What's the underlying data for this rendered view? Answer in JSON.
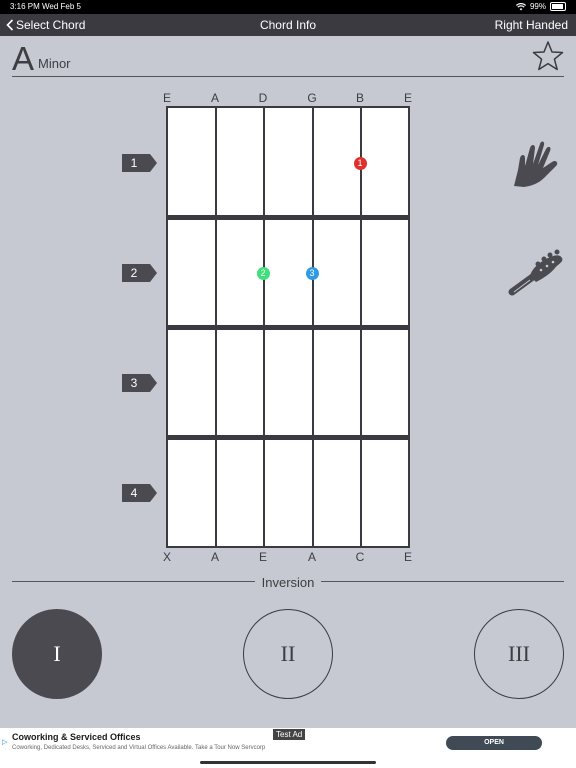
{
  "status": {
    "time": "3:16 PM",
    "date": "Wed Feb 5",
    "battery": "99%",
    "icons": [
      "wifi-icon",
      "battery-icon"
    ]
  },
  "nav": {
    "back_label": "Select Chord",
    "title": "Chord Info",
    "right_label": "Right Handed"
  },
  "chord": {
    "root": "A",
    "quality": "Minor"
  },
  "strings_top": [
    "E",
    "A",
    "D",
    "G",
    "B",
    "E"
  ],
  "strings_bottom": [
    "X",
    "A",
    "E",
    "A",
    "C",
    "E"
  ],
  "frets": [
    "1",
    "2",
    "3",
    "4"
  ],
  "fingers": [
    {
      "string": 4,
      "fret": 1,
      "finger": "1",
      "color": "#e0302e"
    },
    {
      "string": 2,
      "fret": 2,
      "finger": "2",
      "color": "#3ee07c"
    },
    {
      "string": 3,
      "fret": 2,
      "finger": "3",
      "color": "#2f9be6"
    }
  ],
  "inversion": {
    "label": "Inversion",
    "options": [
      "I",
      "II",
      "III"
    ],
    "selected": 0
  },
  "ad": {
    "title": "Coworking & Serviced Offices",
    "description": "Coworking, Dedicated Desks, Serviced and Virtual Offices Available. Take a Tour Now Servcorp",
    "badge": "Test Ad",
    "cta": "OPEN"
  },
  "colors": {
    "nav": "#3b3a40",
    "background": "#c6c9d1",
    "accent": "#4b4a50"
  }
}
